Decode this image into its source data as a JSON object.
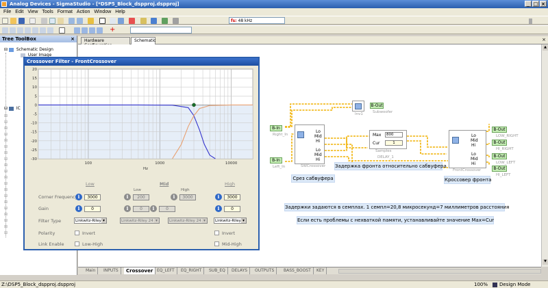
{
  "window": {
    "title": "Analog Devices - SigmaStudio - [*DSP5_Block_dspproj.dspproj]"
  },
  "menu": [
    "File",
    "Edit",
    "View",
    "Tools",
    "Format",
    "Action",
    "Window",
    "Help"
  ],
  "toolbar": {
    "sample_rate": "48 kHz",
    "sample_rate_prefix": "fs:"
  },
  "toolbox": {
    "title": "Tree ToolBox",
    "items": [
      {
        "label": "Schematic Design",
        "icon": "schematic-icon"
      },
      {
        "label": "User Image",
        "icon": "image-icon"
      },
      {
        "label": "IC",
        "icon": "ic-icon"
      }
    ]
  },
  "tabs": [
    {
      "label": "Hardware Configuration"
    },
    {
      "label": "Schematic"
    }
  ],
  "dialog": {
    "title": "Crossover Filter - FrontCrossover",
    "chart_labels": {
      "x_unit": "Hz"
    },
    "bands": [
      "Low",
      "Mid",
      "High"
    ],
    "sub_bands": [
      "Low",
      "High"
    ],
    "rows": {
      "corner_frequency": {
        "label": "Corner Frequency",
        "low": "3000",
        "mid_low": "200",
        "mid_high": "3000",
        "high": "3000"
      },
      "gain": {
        "label": "Gain",
        "low": "0",
        "mid_low": "0",
        "mid": "0",
        "high": "0"
      },
      "filter_type": {
        "label": "Filter Type",
        "low": "Linkwitz-Riley 48",
        "mid_low": "Linkwitz-Riley 24",
        "mid_high": "Linkwitz-Riley 24",
        "high": "Linkwitz-Riley 48"
      },
      "polarity": {
        "label": "Polarity",
        "low_cb": "Invert",
        "high_cb": "Invert"
      },
      "link_enable": {
        "label": "Link Enable",
        "low_cb": "Low-High",
        "high_cb": "Mid-High"
      }
    }
  },
  "chart_data": {
    "type": "line",
    "title": "",
    "xlabel": "Hz",
    "ylabel": "",
    "xscale": "log",
    "xlim": [
      20,
      20000
    ],
    "ylim": [
      -30,
      20
    ],
    "x_ticks": [
      100,
      1000,
      10000
    ],
    "y_ticks": [
      20,
      15,
      10,
      5,
      0,
      -5,
      -10,
      -15,
      -20,
      -25,
      -30
    ],
    "series": [
      {
        "color": "#3333cc",
        "x": [
          20,
          500,
          1500,
          2500,
          3000,
          3600,
          4200,
          5000,
          6000
        ],
        "y": [
          0,
          0,
          -0.1,
          -1.5,
          -6,
          -14,
          -22,
          -28,
          -30
        ]
      },
      {
        "color": "#e8a070",
        "x": [
          1500,
          2000,
          2500,
          3000,
          3600,
          5000,
          10000,
          20000
        ],
        "y": [
          -30,
          -22,
          -12,
          -6,
          -2,
          -0.3,
          0,
          0
        ]
      }
    ],
    "markers": [
      {
        "x": 3000,
        "y": 0
      }
    ]
  },
  "schematic": {
    "inputs": [
      {
        "label": "B-In",
        "name": "Right_In"
      },
      {
        "label": "B-In",
        "name": "Left_In"
      }
    ],
    "blocks": {
      "sw": {
        "name": "SWCrossover",
        "pins": [
          "Lo",
          "Mid",
          "Hi",
          "Lo",
          "Mid",
          "Hi"
        ]
      },
      "inv": {
        "name": "Inv1"
      },
      "delay": {
        "name": "DELAY_1",
        "max_label": "Max",
        "max_val": "800",
        "cur_label": "Cur",
        "cur_val": "1",
        "unit": "Samples"
      },
      "front": {
        "name": "FrontCrossover",
        "pins": [
          "Lo",
          "Mid",
          "Hi",
          "Lo",
          "Mid",
          "Hi"
        ]
      }
    },
    "sub_out": {
      "label": "B-Out",
      "name": "Subwoofer"
    },
    "outputs": [
      {
        "label": "B-Out",
        "name": "LOW_RIGHT"
      },
      {
        "label": "B-Out",
        "name": "HI_RIGHT"
      },
      {
        "label": "B-Out",
        "name": "LOW_LEFT"
      },
      {
        "label": "B-Out",
        "name": "HI_LEFT"
      }
    ],
    "notes": {
      "sw_cut": "Срез сабвуфера",
      "delay_front": "Задержка фронта относительно сабвуфера",
      "front_cross": "Кроссовер фронта",
      "delay_samples": "Задержки задаются в семплах. 1 семпл=20,8 микросекунд=7 миллиметров расстояния",
      "memory_hint": "Если есть проблемы с нехваткой памяти, устанавливайте значение Max=Cur"
    }
  },
  "bottom_tabs": [
    "Main",
    "INPUTS",
    "Crossover",
    "EQ_LEFT",
    "EQ_RIGHT",
    "SUB_EQ",
    "DELAYS",
    "OUTPUTS",
    "BASS_BOOST",
    "KEY"
  ],
  "active_bottom_tab": "Crossover",
  "status": {
    "path": "Z:\\DSP5_Block_dspproj.dspproj",
    "zoom": "100%",
    "mode": "Design Mode"
  },
  "colors": {
    "accent": "#2b5fae",
    "wire": "#f0b000",
    "note_bg": "#dce9f8",
    "io_bg": "#c6efb6"
  }
}
